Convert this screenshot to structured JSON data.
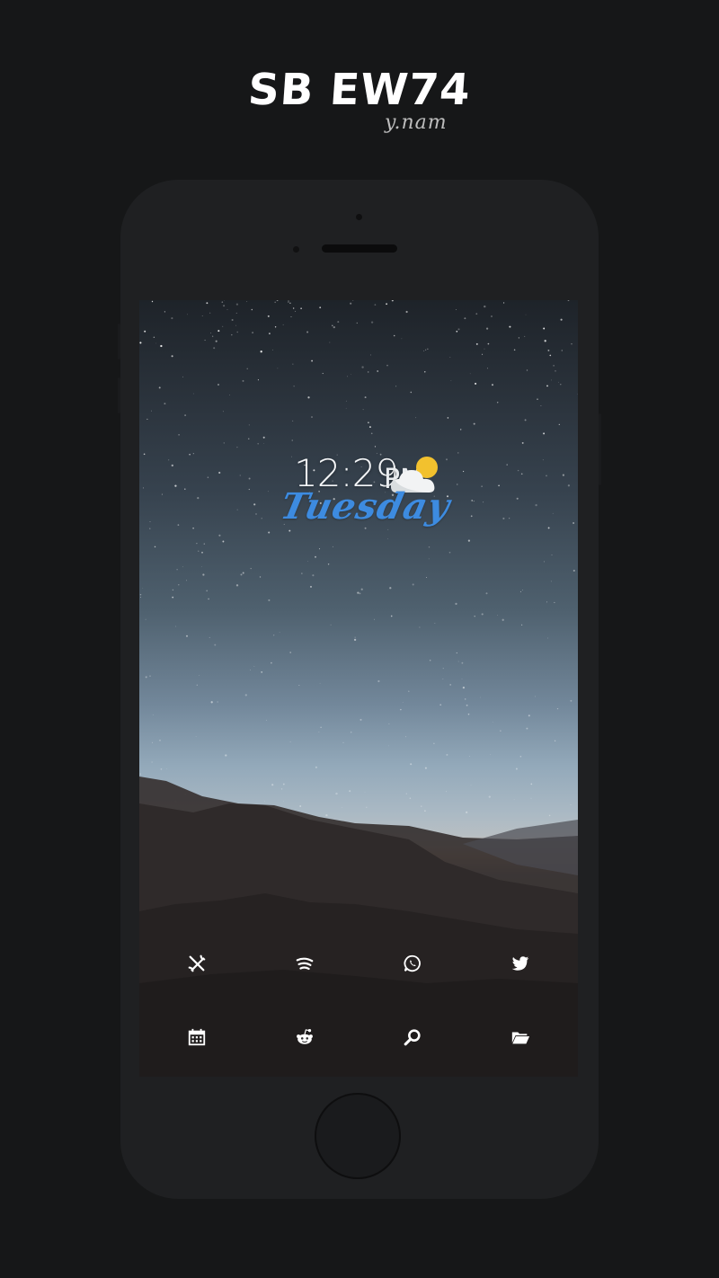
{
  "header": {
    "title": "SB EW74",
    "subtitle": "y.nam"
  },
  "widget": {
    "time": "12:29",
    "ampm": "PM",
    "day": "Tuesday",
    "weather_icon": "partly-cloudy-icon",
    "day_color": "#3d8be0"
  },
  "dock": {
    "rows": [
      [
        {
          "name": "settings-tools-icon"
        },
        {
          "name": "spotify-icon"
        },
        {
          "name": "whatsapp-icon"
        },
        {
          "name": "twitter-icon"
        }
      ],
      [
        {
          "name": "calendar-icon"
        },
        {
          "name": "reddit-icon"
        },
        {
          "name": "search-icon"
        },
        {
          "name": "folder-icon"
        }
      ]
    ]
  },
  "colors": {
    "background": "#161718",
    "phone_body": "#1f2022",
    "sunset": "#d9a272"
  }
}
